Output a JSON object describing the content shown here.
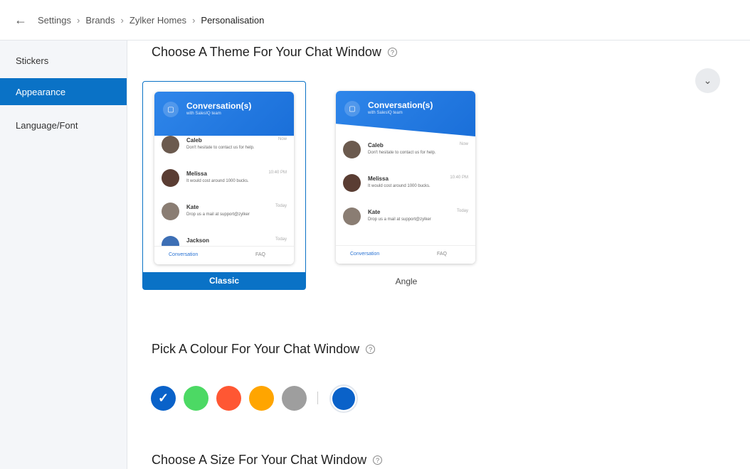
{
  "breadcrumb": {
    "items": [
      "Settings",
      "Brands",
      "Zylker Homes",
      "Personalisation"
    ]
  },
  "sidebar": {
    "items": [
      {
        "label": "Stickers"
      },
      {
        "label": "Appearance"
      },
      {
        "label": "Language/Font"
      }
    ],
    "active_index": 1
  },
  "theme_section": {
    "heading": "Choose A Theme For Your Chat Window",
    "themes": [
      {
        "label": "Classic",
        "selected": true
      },
      {
        "label": "Angle",
        "selected": false
      }
    ],
    "preview": {
      "title": "Conversation(s)",
      "subtitle": "with SalesIQ team",
      "chats": [
        {
          "name": "Caleb",
          "message": "Don't hesitate to contact us for help.",
          "time": "Now"
        },
        {
          "name": "Melissa",
          "message": "It would cost around 1000 bucks.",
          "time": "10:40 PM"
        },
        {
          "name": "Kate",
          "message": "Drop us a mail at support@zylker",
          "time": "Today"
        },
        {
          "name": "Jackson",
          "message": "",
          "time": "Today"
        }
      ],
      "footer_tabs": [
        "Conversation",
        "FAQ"
      ]
    }
  },
  "colour_section": {
    "heading": "Pick A Colour For Your Chat Window",
    "swatches": [
      {
        "color": "#0a62c9",
        "selected": true
      },
      {
        "color": "#4cd964",
        "selected": false
      },
      {
        "color": "#ff5733",
        "selected": false
      },
      {
        "color": "#ffa500",
        "selected": false
      },
      {
        "color": "#9e9e9e",
        "selected": false
      }
    ],
    "custom_color": "#0a62c9"
  },
  "size_section": {
    "heading": "Choose A Size For Your Chat Window"
  },
  "icons": {
    "back": "arrow-left-icon",
    "help": "question-circle-icon",
    "collapse": "chevron-down-icon",
    "check": "check-icon"
  }
}
